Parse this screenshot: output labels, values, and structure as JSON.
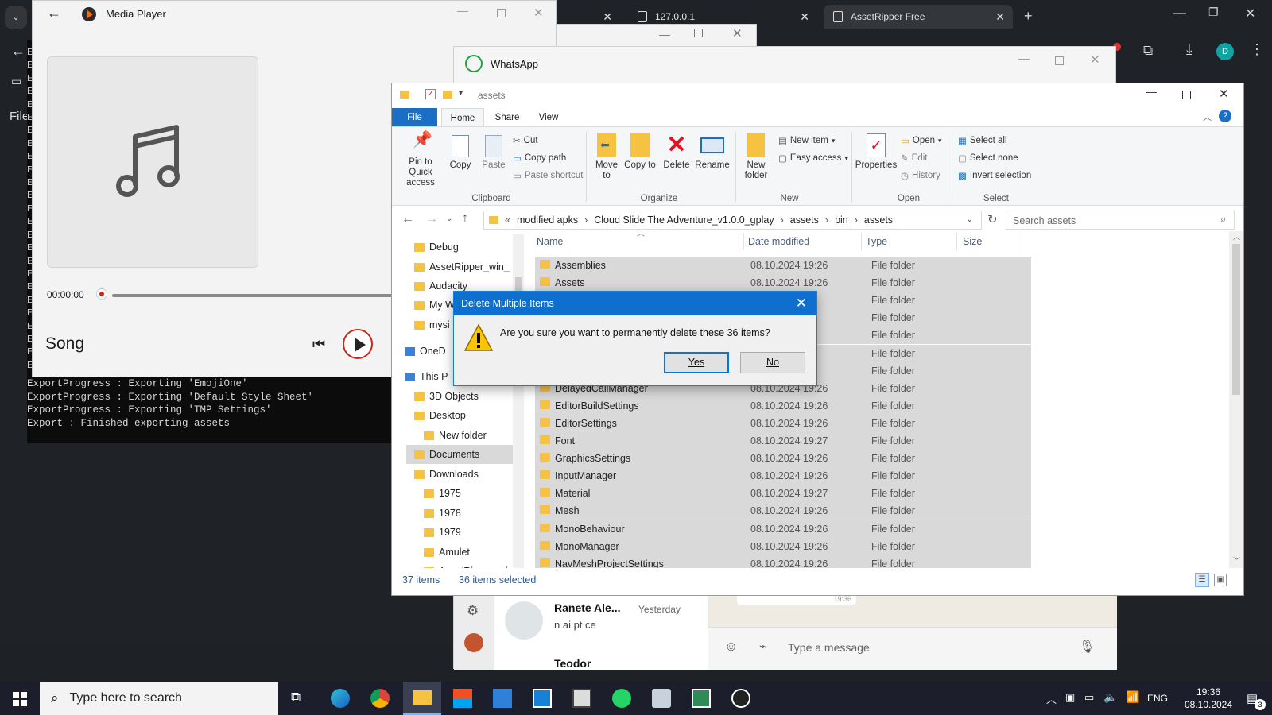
{
  "chrome": {
    "tabs": [
      {
        "label": "127.0.0.1"
      },
      {
        "label": "AssetRipper Free"
      }
    ],
    "new_tab": "+",
    "sidebar_label": "File"
  },
  "terminal": {
    "left_letters": "E\nE\nE\nE\nE\nE\nE\nE\nE\nE\nE\nE\nE\nE\nE\nE\nE\nE\nE\nE\nE\nE\nE\nE\nE",
    "lines": "ExportProgress : Exporting 'EmojiOne'\nExportProgress : Exporting 'Default Style Sheet'\nExportProgress : Exporting 'TMP Settings'\nExport : Finished exporting assets"
  },
  "media_player": {
    "title": "Media Player",
    "time": "00:00:00",
    "song": "Song"
  },
  "whatsapp": {
    "title": "WhatsApp",
    "chat_name": "Ranete Ale...",
    "chat_time": "Yesterday",
    "chat_preview": "n ai pt ce",
    "chat_name_2": "Teodor",
    "bubble_time": "19:36",
    "input_placeholder": "Type a message"
  },
  "explorer": {
    "title": "assets",
    "ribbon_tabs": {
      "file": "File",
      "home": "Home",
      "share": "Share",
      "view": "View"
    },
    "ribbon": {
      "pin": "Pin to Quick access",
      "copy": "Copy",
      "paste": "Paste",
      "cut": "Cut",
      "copy_path": "Copy path",
      "paste_shortcut": "Paste shortcut",
      "clipboard": "Clipboard",
      "move_to": "Move to",
      "copy_to": "Copy to",
      "delete": "Delete",
      "rename": "Rename",
      "organize": "Organize",
      "new_folder": "New folder",
      "new_item": "New item",
      "easy_access": "Easy access",
      "new_group": "New",
      "properties": "Properties",
      "open": "Open",
      "edit": "Edit",
      "history": "History",
      "open_group": "Open",
      "select_all": "Select all",
      "select_none": "Select none",
      "invert_selection": "Invert selection",
      "select_group": "Select"
    },
    "address": [
      "modified apks",
      "Cloud Slide The Adventure_v1.0.0_gplay",
      "assets",
      "bin",
      "assets"
    ],
    "address_prefix": "«",
    "search_placeholder": "Search assets",
    "nav": [
      {
        "label": "Debug",
        "indent": 0
      },
      {
        "label": "AssetRipper_win_",
        "indent": 0
      },
      {
        "label": "Audacity",
        "indent": 0
      },
      {
        "label": "My W",
        "indent": 0
      },
      {
        "label": "mysi",
        "indent": 0
      },
      {
        "label": "OneD",
        "indent": -1
      },
      {
        "label": "This P",
        "indent": -1
      },
      {
        "label": "3D Objects",
        "indent": 0
      },
      {
        "label": "Desktop",
        "indent": 0
      },
      {
        "label": "New folder",
        "indent": 1
      },
      {
        "label": "Documents",
        "indent": 0
      },
      {
        "label": "Downloads",
        "indent": 0
      },
      {
        "label": "1975",
        "indent": 1
      },
      {
        "label": "1978",
        "indent": 1
      },
      {
        "label": "1979",
        "indent": 1
      },
      {
        "label": "Amulet",
        "indent": 1
      },
      {
        "label": "AssetRipper_wi",
        "indent": 1
      }
    ],
    "columns": {
      "name": "Name",
      "date": "Date modified",
      "type": "Type",
      "size": "Size"
    },
    "rows": [
      {
        "name": "Assemblies",
        "date": "08.10.2024 19:26",
        "type": "File folder"
      },
      {
        "name": "Assets",
        "date": "08.10.2024 19:26",
        "type": "File folder"
      },
      {
        "name": "",
        "date": "26",
        "type": "File folder"
      },
      {
        "name": "",
        "date": "26",
        "type": "File folder"
      },
      {
        "name": "",
        "date": "26",
        "type": "File folder"
      },
      {
        "name": "",
        "date": "26",
        "type": "File folder"
      },
      {
        "name": "",
        "date": "26",
        "type": "File folder"
      },
      {
        "name": "DelayedCallManager",
        "date": "08.10.2024 19:26",
        "type": "File folder"
      },
      {
        "name": "EditorBuildSettings",
        "date": "08.10.2024 19:26",
        "type": "File folder"
      },
      {
        "name": "EditorSettings",
        "date": "08.10.2024 19:26",
        "type": "File folder"
      },
      {
        "name": "Font",
        "date": "08.10.2024 19:27",
        "type": "File folder"
      },
      {
        "name": "GraphicsSettings",
        "date": "08.10.2024 19:26",
        "type": "File folder"
      },
      {
        "name": "InputManager",
        "date": "08.10.2024 19:26",
        "type": "File folder"
      },
      {
        "name": "Material",
        "date": "08.10.2024 19:27",
        "type": "File folder"
      },
      {
        "name": "Mesh",
        "date": "08.10.2024 19:26",
        "type": "File folder"
      },
      {
        "name": "MonoBehaviour",
        "date": "08.10.2024 19:26",
        "type": "File folder"
      },
      {
        "name": "MonoManager",
        "date": "08.10.2024 19:26",
        "type": "File folder"
      },
      {
        "name": "NavMeshProjectSettings",
        "date": "08.10.2024 19:26",
        "type": "File folder"
      }
    ],
    "status_items": "37 items",
    "status_selected": "36 items selected"
  },
  "dialog": {
    "title": "Delete Multiple Items",
    "close": "✕",
    "message": "Are you sure you want to permanently delete these 36 items?",
    "yes": "Yes",
    "no": "No"
  },
  "taskbar": {
    "search_placeholder": "Type here to search",
    "language": "ENG",
    "time": "19:36",
    "date": "08.10.2024",
    "notifications": "3"
  },
  "colors": {
    "accent": "#0f6fcf",
    "folder": "#f5c242",
    "delete_red": "#e81123",
    "selection": "#d9d9d9"
  }
}
